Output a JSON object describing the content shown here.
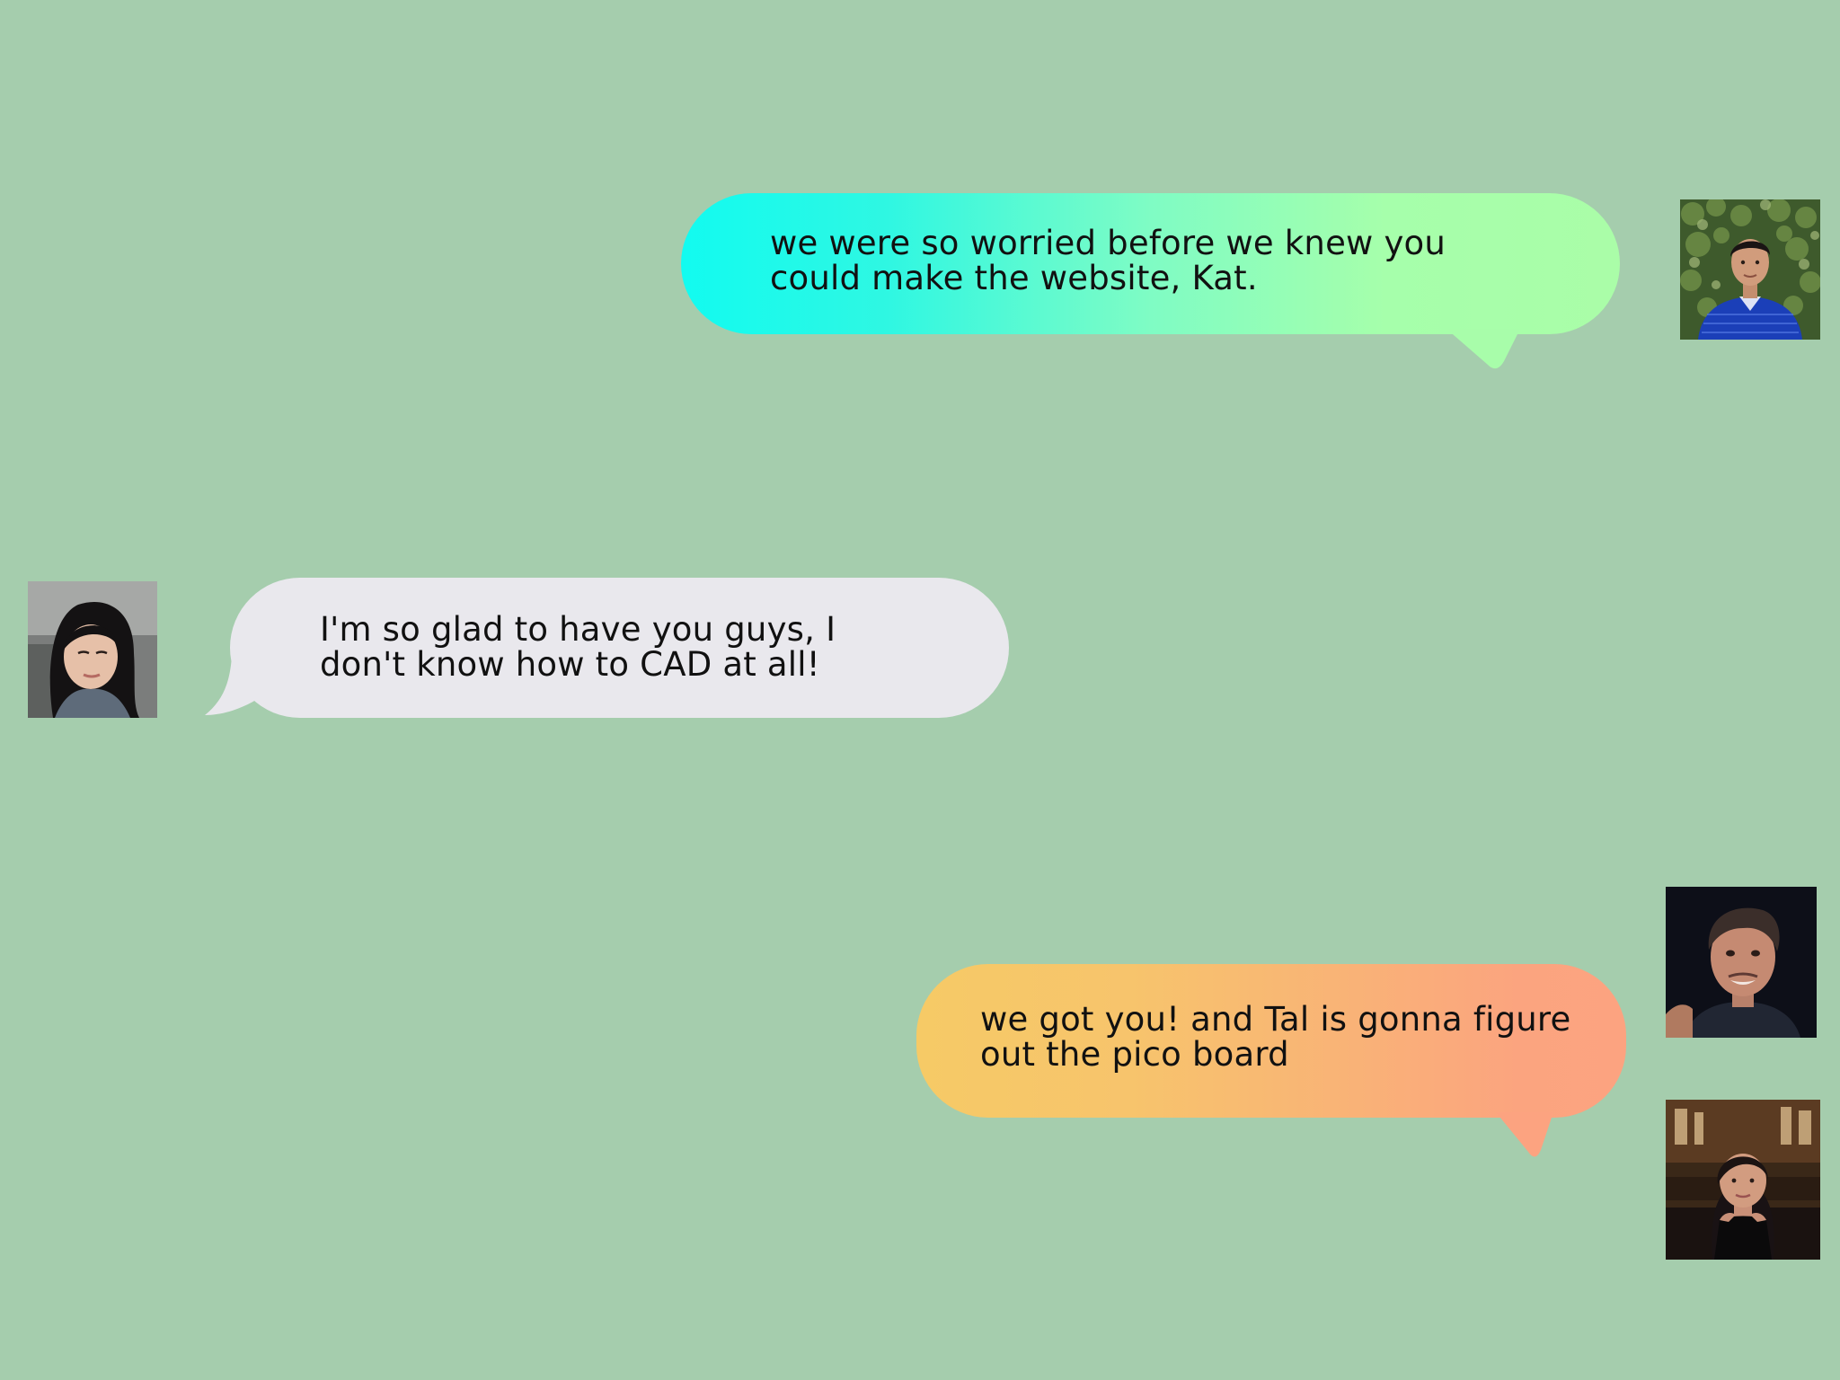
{
  "background_color": "#a5cdad",
  "messages": [
    {
      "side": "right",
      "line1": "we were so worried before we knew you",
      "line2": "could make the website, Kat.",
      "colors": [
        "#12fbf0",
        "#aafda8"
      ]
    },
    {
      "side": "left",
      "line1": "I'm so glad to have you guys, I",
      "line2": "don't know how to CAD at all!",
      "colors": [
        "#e9e8ed"
      ]
    },
    {
      "side": "right",
      "line1": "we got you! and Tal is gonna figure",
      "line2": "out the pico board",
      "colors": [
        "#f6ca66",
        "#fca380"
      ]
    }
  ],
  "avatars": [
    {
      "icon": "man-blue-polo-ivy-avatar"
    },
    {
      "icon": "woman-long-black-hair-avatar"
    },
    {
      "icon": "man-dark-background-avatar"
    },
    {
      "icon": "woman-restaurant-avatar"
    }
  ]
}
